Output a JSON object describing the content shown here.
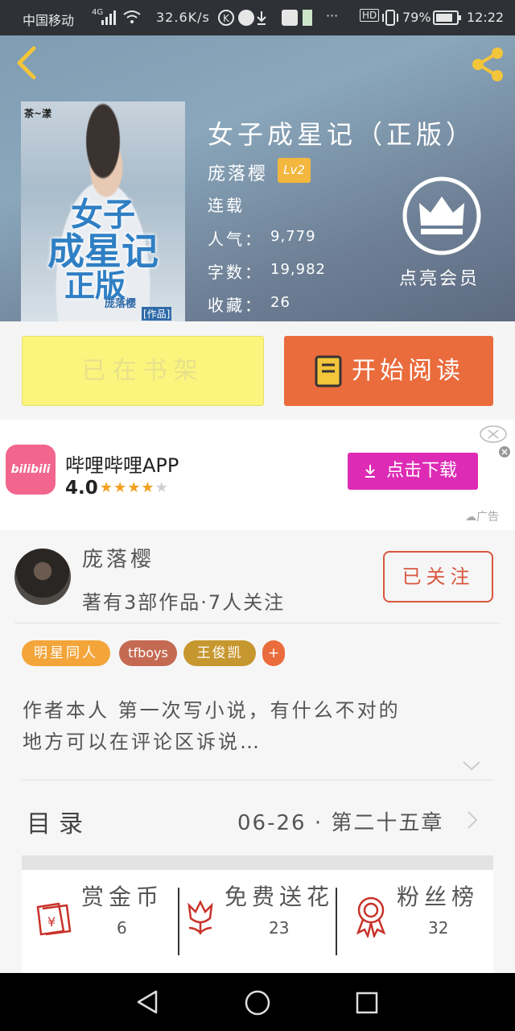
{
  "status_bar": {
    "carrier": "中国移动",
    "network": "4G",
    "speed": "32.6K/s",
    "hd": "HD",
    "battery": "79%",
    "time": "12:22"
  },
  "book": {
    "title": "女子成星记（正版）",
    "author": "庞落樱",
    "level": "Lv2",
    "status": "连载",
    "popularity_label": "人气：",
    "popularity": "9,779",
    "words_label": "字数：",
    "words": "19,982",
    "favorites_label": "收藏：",
    "favorites": "26",
    "member_label": "点亮会员",
    "cover": {
      "brand": "茶~漾",
      "title_line1": "女子",
      "title_line2": "成星记",
      "title_line3": "正版",
      "author": "庞落樱",
      "works": "[作品]"
    }
  },
  "actions": {
    "shelf_label": "已在书架",
    "read_label": "开始阅读"
  },
  "ad": {
    "app_name": "哔哩哔哩APP",
    "rating": "4.0",
    "stars_filled": 4,
    "stars_total": 5,
    "download_label": "点击下载",
    "ad_label": "广告",
    "logo_text": "bilibili"
  },
  "author_card": {
    "name": "庞落樱",
    "stats": "著有3部作品·7人关注",
    "follow_label": "已关注",
    "tags": [
      "明星同人",
      "tfboys",
      "王俊凯",
      "+"
    ],
    "intro_line1": "作者本人 第一次写小说，有什么不对的",
    "intro_line2": "地方可以在评论区诉说…"
  },
  "catalog": {
    "label": "目录",
    "latest": "06-26 · 第二十五章"
  },
  "bottom_stats": [
    {
      "label": "赏金币",
      "value": "6"
    },
    {
      "label": "免费送花",
      "value": "23"
    },
    {
      "label": "粉丝榜",
      "value": "32"
    }
  ],
  "colors": {
    "accent_orange": "#ea6b3c",
    "shelf_yellow": "#fbf57d",
    "level_badge": "#f3b63f",
    "follow_red": "#d9573f",
    "download_magenta": "#dd2bb5",
    "tag_orange": "#f3a53a",
    "tag_brown": "#c56a52",
    "tag_gold": "#c7972f"
  }
}
